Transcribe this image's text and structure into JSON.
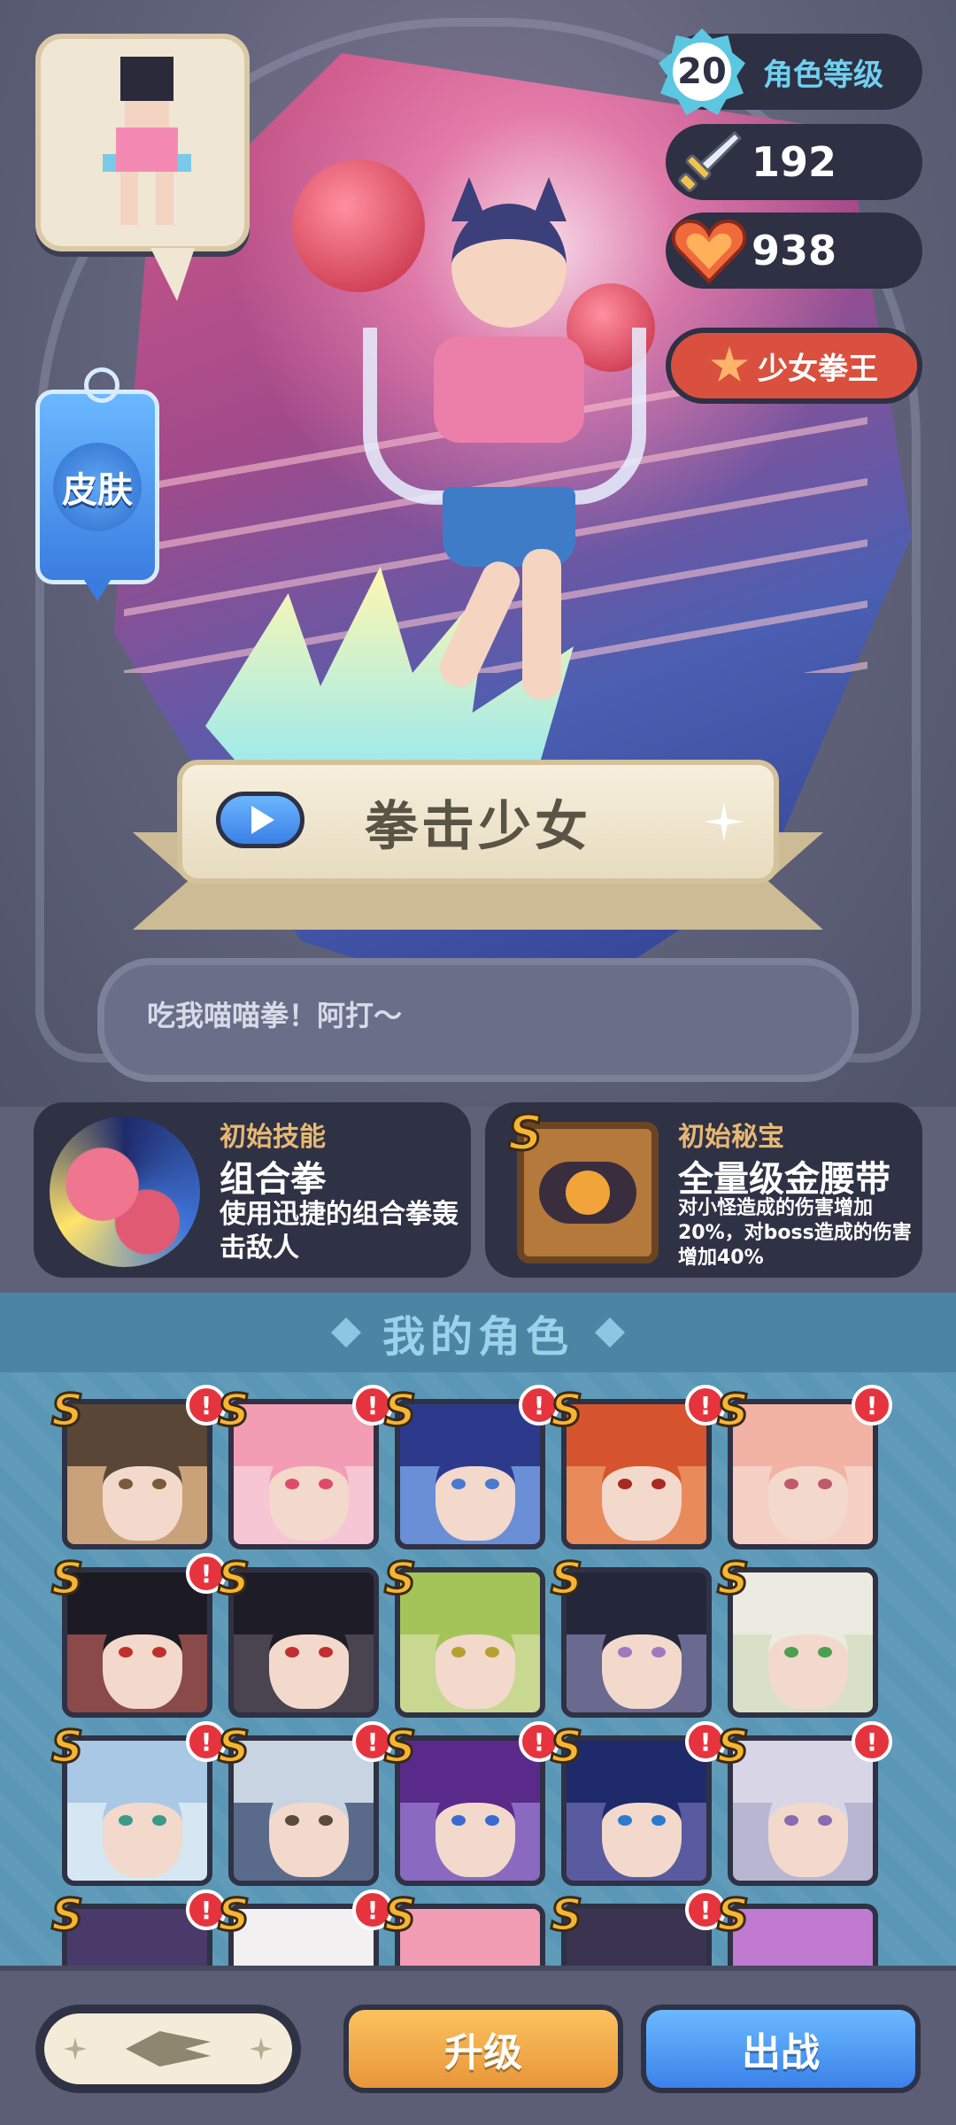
{
  "character": {
    "name": "拳击少女",
    "quote": "吃我喵喵拳！阿打～",
    "level": "20",
    "level_label": "角色等级",
    "attack": "192",
    "health": "938",
    "title": "少女拳王"
  },
  "skin_button_label": "皮肤",
  "skill": {
    "tag": "初始技能",
    "name": "组合拳",
    "description": "使用迅捷的组合拳轰击敌人"
  },
  "treasure": {
    "rank": "S",
    "tag": "初始秘宝",
    "name": "全量级金腰带",
    "description": "对小怪造成的伤害增加20%，对boss造成的伤害增加40%"
  },
  "roster": {
    "title": "我的角色",
    "rank_label": "S",
    "alert_label": "!",
    "characters": [
      {
        "rank": "S",
        "alert": true,
        "hair": "#5a4636",
        "bg": "#c9a27a",
        "eye": "#7a5a3a"
      },
      {
        "rank": "S",
        "alert": true,
        "hair": "#f29db4",
        "bg": "#f6c6d4",
        "eye": "#e04a6a"
      },
      {
        "rank": "S",
        "alert": true,
        "hair": "#2d3a8c",
        "bg": "#6a8fd6",
        "eye": "#4a7ad0"
      },
      {
        "rank": "S",
        "alert": true,
        "hair": "#d6542e",
        "bg": "#e88a5a",
        "eye": "#a82a20"
      },
      {
        "rank": "S",
        "alert": true,
        "hair": "#f2b2a4",
        "bg": "#f6d0c4",
        "eye": "#c05a6a"
      },
      {
        "rank": "S",
        "alert": true,
        "hair": "#1c1a22",
        "bg": "#8a4a4a",
        "eye": "#c0302a"
      },
      {
        "rank": "S",
        "alert": false,
        "hair": "#1e1c26",
        "bg": "#4a4450",
        "eye": "#c03030"
      },
      {
        "rank": "S",
        "alert": false,
        "hair": "#a4c45a",
        "bg": "#c8d890",
        "eye": "#b8a030"
      },
      {
        "rank": "S",
        "alert": false,
        "hair": "#24263a",
        "bg": "#6a6a90",
        "eye": "#a078c0"
      },
      {
        "rank": "S",
        "alert": false,
        "hair": "#ecebe2",
        "bg": "#d8e0c8",
        "eye": "#4aa050"
      },
      {
        "rank": "S",
        "alert": true,
        "hair": "#a8c8e6",
        "bg": "#d6e6f2",
        "eye": "#3a9a8a"
      },
      {
        "rank": "S",
        "alert": true,
        "hair": "#c8d4e2",
        "bg": "#5a6a8a",
        "eye": "#5a4a3a"
      },
      {
        "rank": "S",
        "alert": true,
        "hair": "#5a2a8a",
        "bg": "#8a6ac0",
        "eye": "#3a6ad0"
      },
      {
        "rank": "S",
        "alert": true,
        "hair": "#1e2a6a",
        "bg": "#5a5aa0",
        "eye": "#2a7ad0"
      },
      {
        "rank": "S",
        "alert": true,
        "hair": "#d8d6e6",
        "bg": "#b8b6d0",
        "eye": "#8a6ab0"
      },
      {
        "rank": "S",
        "alert": true,
        "hair": "#4a3a6a",
        "bg": "#6a8ab0",
        "eye": "#c0402a"
      },
      {
        "rank": "S",
        "alert": true,
        "hair": "#f2f0f0",
        "bg": "#d8d0d0",
        "eye": "#c03030"
      },
      {
        "rank": "S",
        "alert": false,
        "hair": "#f29db4",
        "bg": "#f6c6d4",
        "eye": "#c04a6a"
      },
      {
        "rank": "S",
        "alert": true,
        "hair": "#3a3450",
        "bg": "#8a8aa0",
        "eye": "#4a4a6a"
      },
      {
        "rank": "S",
        "alert": false,
        "hair": "#c07ad0",
        "bg": "#e0a8e8",
        "eye": "#8a3aa0"
      }
    ]
  },
  "buttons": {
    "upgrade": "升级",
    "deploy": "出战"
  },
  "colors": {
    "background": "#5e6178",
    "card": "#2f3145",
    "rank_gold": "#f7b531",
    "upgrade": "#f0a846",
    "deploy": "#4a92f0",
    "title_pill": "#d9503e"
  },
  "icons": {
    "attack": "sword-icon",
    "health": "heart-icon",
    "title": "star-icon",
    "play": "play-icon"
  }
}
